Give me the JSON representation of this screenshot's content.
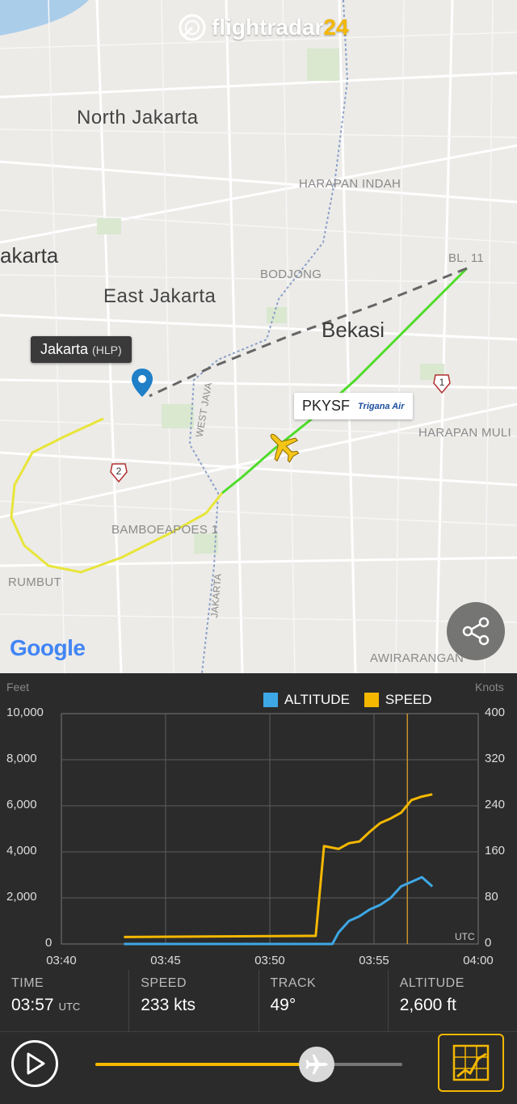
{
  "app": {
    "logo_text": "flightradar",
    "logo_num": "24"
  },
  "map": {
    "labels": {
      "north_jakarta": "North Jakarta",
      "harapan_indah": "HARAPAN INDAH",
      "jakarta_partial": "akarta",
      "bodjong": "BODJONG",
      "bl11": "BL. 11",
      "east_jakarta": "East Jakarta",
      "bekasi": "Bekasi",
      "west_java": "WEST JAVA",
      "route1": "1",
      "route2": "2",
      "harapan_mulia": "HARAPAN MULI",
      "bamboe": "BAMBOEAPOES 1",
      "rumbut": "RUMBUT",
      "jakarta_road": "JAKARTA",
      "awirarangan": "AWIRARANGAN"
    },
    "airport": {
      "name": "Jakarta",
      "code": "(HLP)"
    },
    "flight": {
      "registration": "PKYSF",
      "airline": "Trigana Air"
    },
    "google": "Google",
    "colors": {
      "track_yellow": "#e8e53a",
      "track_green": "#4fdc2a",
      "plane": "#f5c518",
      "pin": "#1f7fc7"
    }
  },
  "chart": {
    "unit_left": "Feet",
    "unit_right": "Knots",
    "legend_altitude": "ALTITUDE",
    "legend_speed": "SPEED",
    "utc_label": "UTC",
    "left_ticks": [
      "10,000",
      "8,000",
      "6,000",
      "4,000",
      "2,000",
      "0"
    ],
    "right_ticks": [
      "400",
      "320",
      "240",
      "160",
      "80",
      "0"
    ],
    "x_ticks": [
      "03:40",
      "03:45",
      "03:50",
      "03:55",
      "04:00"
    ]
  },
  "chart_data": {
    "type": "line",
    "xlabel": "UTC",
    "ylabel_left": "Feet",
    "ylabel_right": "Knots",
    "x_ticks": [
      "03:40",
      "03:45",
      "03:50",
      "03:55",
      "04:00"
    ],
    "x_range_minutes": [
      0,
      20
    ],
    "ylim_left": [
      0,
      10000
    ],
    "ylim_right": [
      0,
      400
    ],
    "cursor_minute": 16.6,
    "grid": true,
    "legend_position": "top",
    "series": [
      {
        "name": "ALTITUDE",
        "axis": "left",
        "color": "#3ea8e6",
        "x": [
          3.0,
          13.0,
          13.0,
          13.3,
          13.8,
          14.3,
          14.8,
          15.3,
          15.8,
          16.3,
          16.8,
          17.3,
          17.8
        ],
        "y": [
          0,
          0,
          0,
          500,
          1000,
          1200,
          1500,
          1700,
          2000,
          2500,
          2700,
          2900,
          2500
        ]
      },
      {
        "name": "SPEED",
        "axis": "right",
        "color": "#f5b800",
        "x": [
          3.0,
          12.2,
          12.6,
          13.3,
          13.8,
          14.3,
          14.8,
          15.3,
          15.8,
          16.3,
          16.8,
          17.3,
          17.8
        ],
        "y": [
          12,
          14,
          170,
          165,
          175,
          178,
          195,
          210,
          218,
          228,
          250,
          256,
          260
        ]
      }
    ]
  },
  "stats": {
    "time_label": "TIME",
    "time_value": "03:57",
    "time_unit": "UTC",
    "speed_label": "SPEED",
    "speed_value": "233 kts",
    "track_label": "TRACK",
    "track_value": "49°",
    "altitude_label": "ALTITUDE",
    "altitude_value": "2,600 ft"
  },
  "playback": {
    "progress": 0.72
  }
}
